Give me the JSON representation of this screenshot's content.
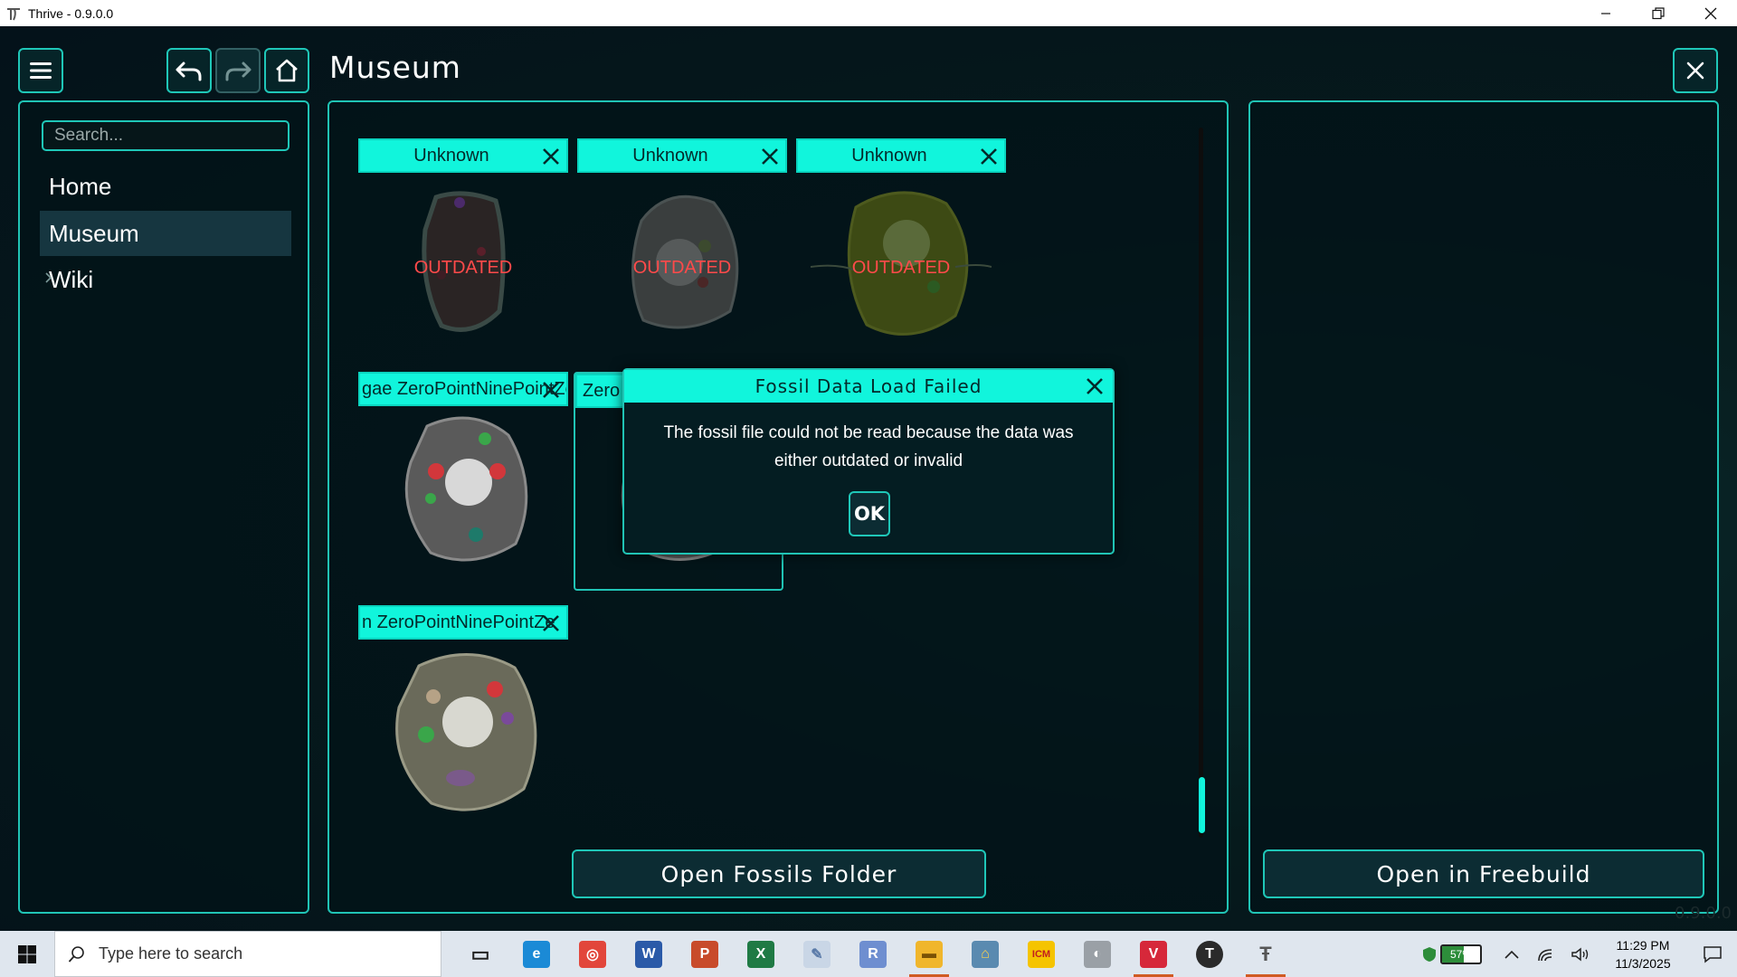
{
  "window": {
    "title": "Thrive - 0.9.0.0",
    "minimize_icon": "minimize-icon",
    "restore_icon": "restore-icon",
    "close_icon": "close-icon"
  },
  "toolbar": {
    "menu_icon": "hamburger-menu-icon",
    "back_icon": "undo-arrow-icon",
    "forward_icon": "redo-arrow-icon",
    "home_icon": "home-icon",
    "close_icon": "close-icon"
  },
  "page": {
    "title": "Museum"
  },
  "sidebar": {
    "search_placeholder": "Search...",
    "items": [
      {
        "label": "Home",
        "active": false,
        "expandable": false
      },
      {
        "label": "Museum",
        "active": true,
        "expandable": false
      },
      {
        "label": "Wiki",
        "active": false,
        "expandable": true
      }
    ]
  },
  "fossils": [
    {
      "name": "Unknown",
      "status": "OUTDATED"
    },
    {
      "name": "Unknown",
      "status": "OUTDATED"
    },
    {
      "name": "Unknown",
      "status": "OUTDATED"
    },
    {
      "name": "gae ZeroPointNinePointZe",
      "status": ""
    },
    {
      "name": "Zero",
      "status": ""
    },
    {
      "name": "n ZeroPointNinePointZe",
      "status": ""
    }
  ],
  "buttons": {
    "open_fossils_folder": "Open Fossils Folder",
    "open_in_freebuild": "Open in Freebuild"
  },
  "dialog": {
    "title": "Fossil Data Load Failed",
    "message": "The fossil file could not be read because the data was either outdated or invalid",
    "ok_label": "OK"
  },
  "version_ghost": "0.9.0.0",
  "taskbar": {
    "search_placeholder": "Type here to search",
    "apps": [
      {
        "name": "task-view-icon",
        "running": false
      },
      {
        "name": "edge-browser-icon",
        "running": false
      },
      {
        "name": "chrome-browser-icon",
        "running": false
      },
      {
        "name": "word-icon",
        "running": false
      },
      {
        "name": "powerpoint-icon",
        "running": false
      },
      {
        "name": "excel-icon",
        "running": false
      },
      {
        "name": "paint-icon",
        "running": false
      },
      {
        "name": "r-app-icon",
        "running": false
      },
      {
        "name": "file-explorer-icon",
        "running": true
      },
      {
        "name": "home-app-icon",
        "running": false
      },
      {
        "name": "icm-app-icon",
        "running": false
      },
      {
        "name": "compass-app-icon",
        "running": false
      },
      {
        "name": "vivaldi-browser-icon",
        "running": true
      },
      {
        "name": "t-app-icon",
        "running": false
      },
      {
        "name": "thrive-app-icon",
        "running": true
      }
    ],
    "battery_percent": "57%",
    "battery_level": 0.57,
    "time": "11:29 PM",
    "date": "11/3/2025"
  },
  "colors": {
    "accent": "#11f5dc",
    "border": "#20c4b5",
    "outdated": "#ff4a4a",
    "panel_bg": "#031418"
  }
}
